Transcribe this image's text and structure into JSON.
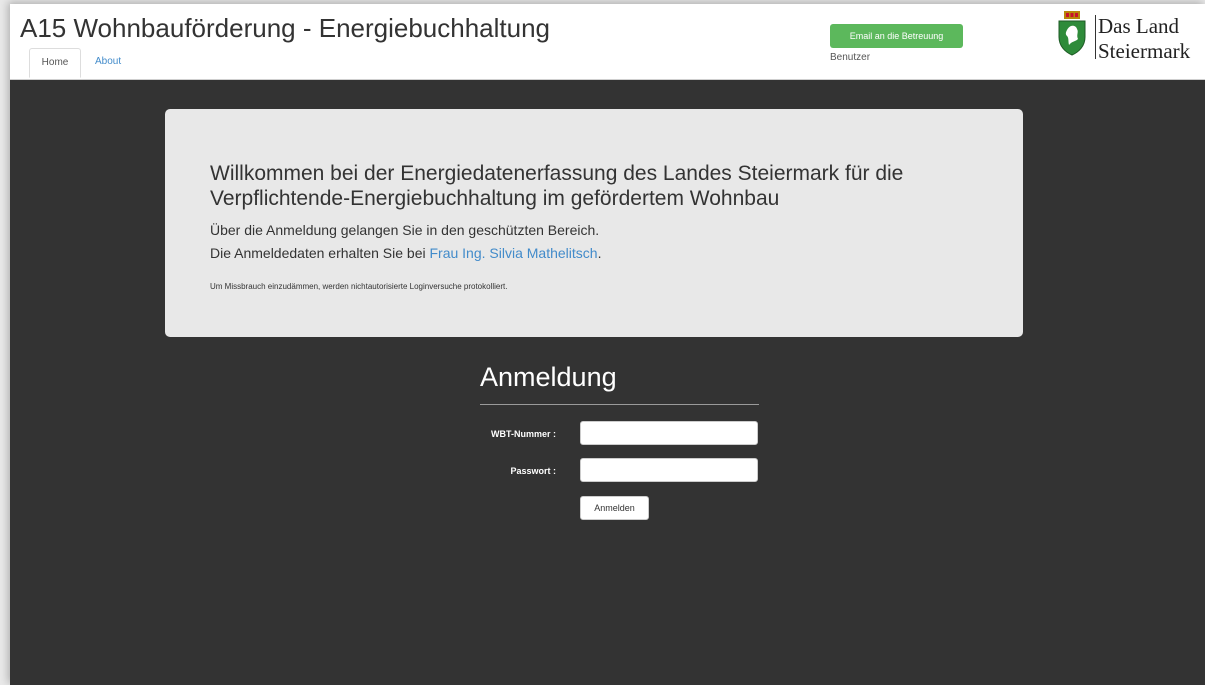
{
  "header": {
    "title": "A15 Wohnbauförderung - Energiebuchhaltung",
    "tabs": [
      {
        "label": "Home",
        "active": true
      },
      {
        "label": "About",
        "active": false
      }
    ],
    "email_button": "Email an die Betreuung",
    "user_label": "Benutzer",
    "logo": {
      "line1": "Das Land",
      "line2": "Steiermark",
      "icon": "steiermark-crest-icon"
    }
  },
  "jumbotron": {
    "heading": "Willkommen bei der Energiedatenerfassung des Landes Steiermark für die Verpflichtende-Energiebuchhaltung im gefördertem Wohnbau",
    "line1": "Über die Anmeldung gelangen Sie in den geschützten Bereich.",
    "line2_prefix": "Die Anmeldedaten erhalten Sie bei ",
    "contact_link": "Frau Ing. Silvia Mathelitsch",
    "line2_suffix": ".",
    "notice": "Um Missbrauch einzudämmen, werden nichtautorisierte Loginversuche protokolliert."
  },
  "login": {
    "title": "Anmeldung",
    "wbt_label": "WBT-Nummer :",
    "wbt_value": "",
    "password_label": "Passwort :",
    "password_value": "",
    "submit_label": "Anmelden"
  },
  "colors": {
    "background": "#333333",
    "jumbotron": "#e8e8e8",
    "email_button": "#5cb85c",
    "link": "#428bca",
    "crest_green": "#2e8b3a"
  }
}
